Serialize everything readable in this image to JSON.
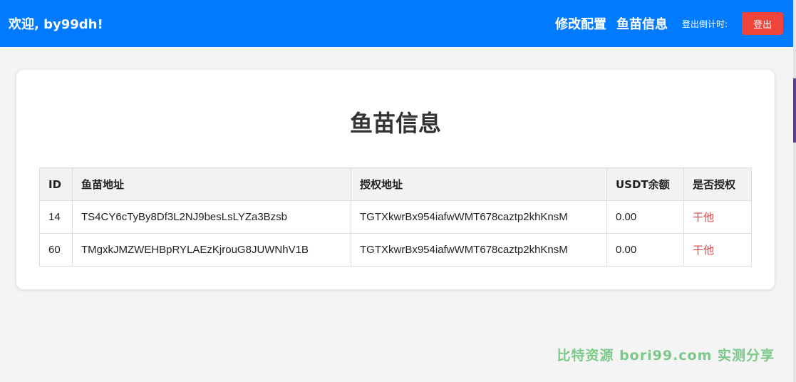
{
  "header": {
    "welcome": "欢迎, by99dh!",
    "nav": [
      "修改配置",
      "鱼苗信息"
    ],
    "countdown": "登出倒计时:",
    "logout_label": "登出"
  },
  "main": {
    "title": "鱼苗信息",
    "table": {
      "columns": [
        "ID",
        "鱼苗地址",
        "授权地址",
        "USDT余额",
        "是否授权"
      ],
      "rows": [
        [
          "14",
          "TS4CY6cTyBy8Df3L2NJ9besLsLYZa3Bzsb",
          "TGTXkwrBx954iafwWMT678caztp2khKnsM",
          "0.00",
          "干他"
        ],
        [
          "60",
          "TMgxkJMZWEHBpRYLAEzKjrouG8JUWNhV1B",
          "TGTXkwrBx954iafwWMT678caztp2khKnsM",
          "0.00",
          "干他"
        ]
      ]
    }
  },
  "watermark": "比特资源 bori99.com 实测分享",
  "colors": {
    "header_bg": "#007bff",
    "logout_bg": "#f0453a",
    "authorize_text": "#e04040",
    "watermark": "#7cc88a"
  }
}
